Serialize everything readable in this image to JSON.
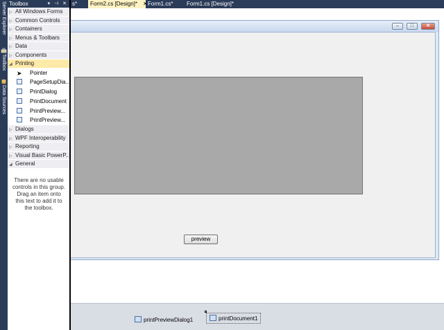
{
  "sidebar": {
    "tabs": [
      {
        "label": "Server Explorer",
        "icon": "server-explorer-icon"
      },
      {
        "label": "Toolbox",
        "icon": "toolbox-icon"
      },
      {
        "label": "Data Sources",
        "icon": "data-sources-icon"
      }
    ]
  },
  "tabs": [
    {
      "label": "s*"
    },
    {
      "label": "Form2.cs [Design]*",
      "close": "✕"
    },
    {
      "label": "Form1.cs*"
    },
    {
      "label": "Form1.cs [Design]*"
    }
  ],
  "toolbox": {
    "title": "Toolbox",
    "buttons": "▾ ⊣ ✕",
    "categories_before": [
      {
        "label": "All Windows Forms"
      },
      {
        "label": "Common Controls"
      },
      {
        "label": "Containers"
      },
      {
        "label": "Menus & Toolbars"
      },
      {
        "label": "Data"
      },
      {
        "label": "Components"
      }
    ],
    "open_category": {
      "label": "Printing"
    },
    "tools": [
      {
        "label": "Pointer",
        "icon": "pointer-icon"
      },
      {
        "label": "PageSetupDia...",
        "icon": "page-setup-dialog-icon"
      },
      {
        "label": "PrintDialog",
        "icon": "print-dialog-icon"
      },
      {
        "label": "PrintDocument",
        "icon": "print-document-icon"
      },
      {
        "label": "PrintPreview...",
        "icon": "print-preview-control-icon"
      },
      {
        "label": "PrintPreview...",
        "icon": "print-preview-dialog-icon"
      }
    ],
    "categories_after": [
      {
        "label": "Dialogs"
      },
      {
        "label": "WPF Interoperability"
      },
      {
        "label": "Reporting"
      },
      {
        "label": "Visual Basic PowerP..."
      }
    ],
    "general": {
      "label": "General"
    },
    "empty_message": "There are no usable controls in this group. Drag an item onto this text to add it to the toolbox."
  },
  "form": {
    "window_buttons": [
      "–",
      "□",
      "✕"
    ],
    "preview_button": "preview"
  },
  "tray": {
    "components": [
      {
        "label": "printPreviewDialog1",
        "icon": "print-preview-dialog-icon"
      },
      {
        "label": "printDocument1",
        "icon": "print-document-icon"
      }
    ]
  }
}
